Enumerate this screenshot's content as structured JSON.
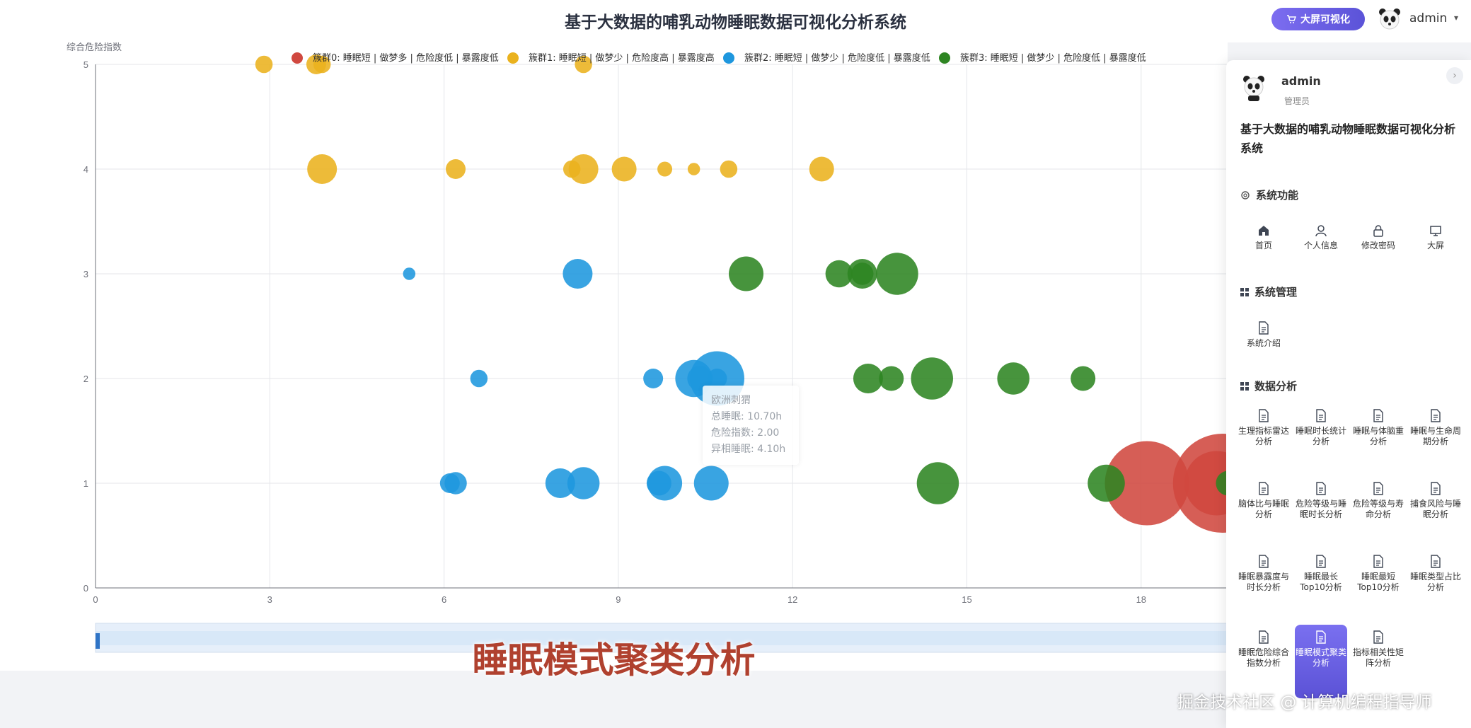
{
  "header": {
    "title": "基于大数据的哺乳动物睡眠数据可视化分析系统",
    "bigscreen_button": "大屏可视化",
    "username": "admin"
  },
  "tooltip": {
    "name": "欧洲刺猬",
    "line1": "总睡眠: 10.70h",
    "line2": "危险指数: 2.00",
    "line3": "异相睡眠: 4.10h"
  },
  "overlay": {
    "subtitle": "睡眠模式聚类分析",
    "watermark": "掘金技术社区 @ 计算机编程指导师"
  },
  "drawer": {
    "username": "admin",
    "role": "管理员",
    "system_title": "基于大数据的哺乳动物睡眠数据可视化分析系统",
    "sections": {
      "functions": {
        "title": "系统功能",
        "items": [
          {
            "label": "首页",
            "icon": "home-icon"
          },
          {
            "label": "个人信息",
            "icon": "user-icon"
          },
          {
            "label": "修改密码",
            "icon": "lock-icon"
          },
          {
            "label": "大屏",
            "icon": "screen-icon"
          }
        ]
      },
      "management": {
        "title": "系统管理",
        "items": [
          {
            "label": "系统介绍",
            "icon": "document-icon"
          }
        ]
      },
      "analysis": {
        "title": "数据分析",
        "items": [
          {
            "label": "生理指标雷达分析",
            "icon": "document-icon"
          },
          {
            "label": "睡眠时长统计分析",
            "icon": "document-icon"
          },
          {
            "label": "睡眠与体脑重分析",
            "icon": "document-icon"
          },
          {
            "label": "睡眠与生命周期分析",
            "icon": "document-icon"
          },
          {
            "label": "脑体比与睡眠分析",
            "icon": "document-icon"
          },
          {
            "label": "危险等级与睡眠时长分析",
            "icon": "document-icon"
          },
          {
            "label": "危险等级与寿命分析",
            "icon": "document-icon"
          },
          {
            "label": "捕食风险与睡眠分析",
            "icon": "document-icon"
          },
          {
            "label": "睡眠暴露度与时长分析",
            "icon": "document-icon"
          },
          {
            "label": "睡眠最长Top10分析",
            "icon": "document-icon"
          },
          {
            "label": "睡眠最短Top10分析",
            "icon": "document-icon"
          },
          {
            "label": "睡眠类型占比分析",
            "icon": "document-icon"
          },
          {
            "label": "睡眠危险综合指数分析",
            "icon": "document-icon"
          },
          {
            "label": "睡眠模式聚类分析",
            "icon": "document-icon",
            "active": true
          },
          {
            "label": "指标相关性矩阵分析",
            "icon": "document-icon"
          }
        ]
      }
    }
  },
  "colors": {
    "cluster0": "#d0483f",
    "cluster1": "#eab21e",
    "cluster2": "#1e97de",
    "cluster3": "#2e8522",
    "accent": "#6c62e6"
  },
  "chart_data": {
    "type": "scatter",
    "ylabel": "综合危险指数",
    "xlabel": "",
    "xlim": [
      0,
      20
    ],
    "ylim": [
      0,
      5
    ],
    "xticks": [
      "0",
      "3",
      "6",
      "9",
      "12",
      "15",
      "18"
    ],
    "yticks": [
      "0",
      "1",
      "2",
      "3",
      "4",
      "5"
    ],
    "legend_position": "top",
    "series": [
      {
        "name": "簇群0: 睡眠短 | 做梦多 | 危险度低 | 暴露度低",
        "color": "#d0483f",
        "points": [
          [
            18.1,
            1,
            3.4
          ],
          [
            19.4,
            1,
            4.0
          ],
          [
            19.3,
            1,
            2.6
          ]
        ]
      },
      {
        "name": "簇群1: 睡眠短 | 做梦少 | 危险度高 | 暴露度高",
        "color": "#eab21e",
        "points": [
          [
            2.9,
            5,
            0.7
          ],
          [
            3.8,
            5,
            0.8
          ],
          [
            3.9,
            5,
            0.7
          ],
          [
            8.4,
            5,
            0.7
          ],
          [
            3.9,
            4,
            1.2
          ],
          [
            6.2,
            4,
            0.8
          ],
          [
            8.2,
            4,
            0.7
          ],
          [
            8.4,
            4,
            1.2
          ],
          [
            9.1,
            4,
            1.0
          ],
          [
            9.8,
            4,
            0.6
          ],
          [
            10.3,
            4,
            0.5
          ],
          [
            10.9,
            4,
            0.7
          ],
          [
            12.5,
            4,
            1.0
          ]
        ]
      },
      {
        "name": "簇群2: 睡眠短 | 做梦少 | 危险度低 | 暴露度低",
        "color": "#1e97de",
        "points": [
          [
            5.4,
            3,
            0.5
          ],
          [
            8.3,
            3,
            1.2
          ],
          [
            6.6,
            2,
            0.7
          ],
          [
            9.6,
            2,
            0.8
          ],
          [
            10.3,
            2,
            1.5
          ],
          [
            10.7,
            2,
            2.2
          ],
          [
            10.4,
            2,
            1.0
          ],
          [
            10.7,
            2,
            0.8
          ],
          [
            6.1,
            1,
            0.8
          ],
          [
            6.2,
            1,
            0.9
          ],
          [
            8.0,
            1,
            1.2
          ],
          [
            8.4,
            1,
            1.3
          ],
          [
            9.7,
            1,
            1.0
          ],
          [
            9.8,
            1,
            1.4
          ],
          [
            10.6,
            1,
            1.4
          ]
        ]
      },
      {
        "name": "簇群3: 睡眠短 | 做梦少 | 危险度低 | 暴露度低",
        "color": "#2e8522",
        "points": [
          [
            11.2,
            3,
            1.4
          ],
          [
            12.8,
            3,
            1.1
          ],
          [
            13.2,
            3,
            1.2
          ],
          [
            13.2,
            3,
            0.9
          ],
          [
            13.8,
            3,
            1.7
          ],
          [
            13.3,
            2,
            1.2
          ],
          [
            13.7,
            2,
            1.0
          ],
          [
            14.4,
            2,
            1.7
          ],
          [
            15.8,
            2,
            1.3
          ],
          [
            17.0,
            2,
            1.0
          ],
          [
            14.5,
            1,
            1.7
          ],
          [
            17.4,
            1,
            1.5
          ],
          [
            19.5,
            1,
            1.0
          ]
        ]
      }
    ]
  }
}
